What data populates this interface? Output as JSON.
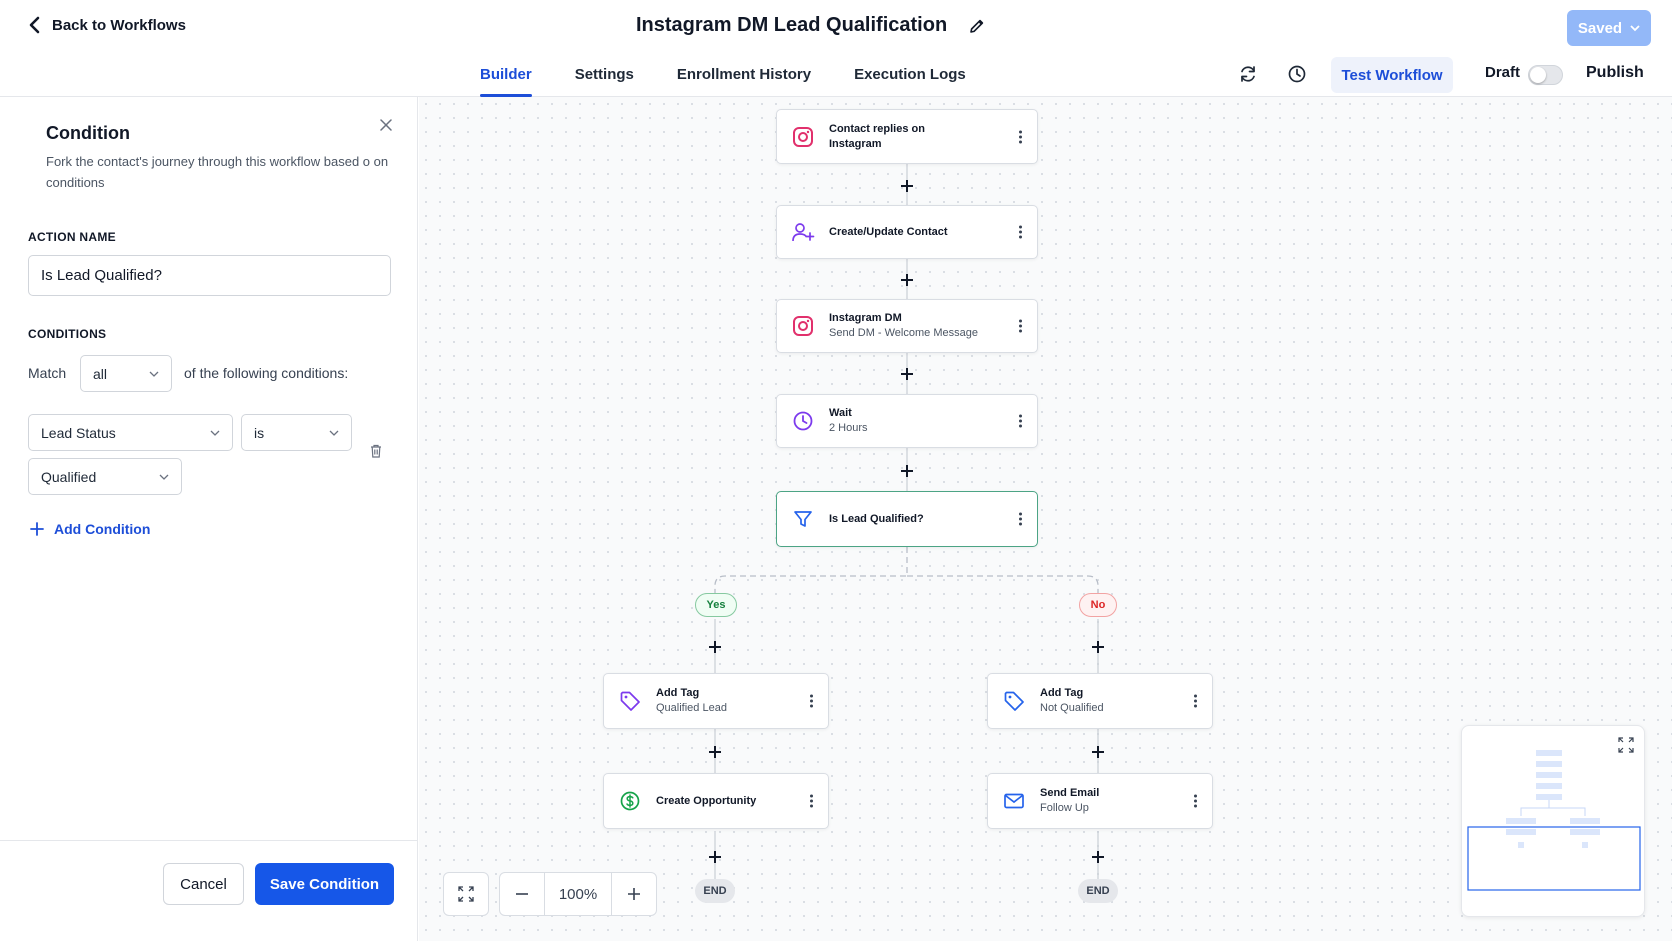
{
  "header": {
    "back_label": "Back to Workflows",
    "title": "Instagram DM Lead Qualification",
    "saved_label": "Saved",
    "tabs": [
      {
        "label": "Builder",
        "active": true
      },
      {
        "label": "Settings",
        "active": false
      },
      {
        "label": "Enrollment History",
        "active": false
      },
      {
        "label": "Execution Logs",
        "active": false
      }
    ],
    "test_label": "Test Workflow",
    "draft_label": "Draft",
    "publish_label": "Publish",
    "draft_toggle_on": false
  },
  "panel": {
    "title": "Condition",
    "description": "Fork the contact's journey through this workflow based o on conditions",
    "action_name_label": "ACTION NAME",
    "action_name_value": "Is Lead Qualified?",
    "conditions_label": "CONDITIONS",
    "match_label": "Match",
    "match_value": "all",
    "match_suffix": "of the following conditions:",
    "condition": {
      "field": "Lead Status",
      "operator": "is",
      "value": "Qualified"
    },
    "add_condition_label": "Add Condition",
    "cancel_label": "Cancel",
    "save_label": "Save Condition"
  },
  "flow": {
    "nodes": [
      {
        "icon": "instagram-icon",
        "title": "Contact replies on Instagram",
        "subtitle": ""
      },
      {
        "icon": "user-plus-icon",
        "title": "Create/Update Contact",
        "subtitle": ""
      },
      {
        "icon": "instagram-icon",
        "title": "Instagram DM",
        "subtitle": "Send DM - Welcome Message"
      },
      {
        "icon": "clock-icon",
        "title": "Wait",
        "subtitle": "2 Hours"
      },
      {
        "icon": "filter-icon",
        "title": "Is Lead Qualified?",
        "subtitle": ""
      }
    ],
    "yes_label": "Yes",
    "no_label": "No",
    "yes_branch": [
      {
        "icon": "tag-icon",
        "title": "Add Tag",
        "subtitle": "Qualified Lead"
      },
      {
        "icon": "dollar-icon",
        "title": "Create Opportunity",
        "subtitle": ""
      }
    ],
    "no_branch": [
      {
        "icon": "tag-icon",
        "title": "Add Tag",
        "subtitle": "Not Qualified"
      },
      {
        "icon": "mail-icon",
        "title": "Send Email",
        "subtitle": "Follow Up"
      }
    ],
    "end_label": "END"
  },
  "zoom": {
    "value": "100%"
  },
  "colors": {
    "accent": "#1657e8",
    "instagram": "#e1306c",
    "purple": "#7c3aed",
    "green": "#16a34a",
    "blue": "#2563eb",
    "yes_green": "#15803d",
    "no_red": "#dc2626"
  }
}
